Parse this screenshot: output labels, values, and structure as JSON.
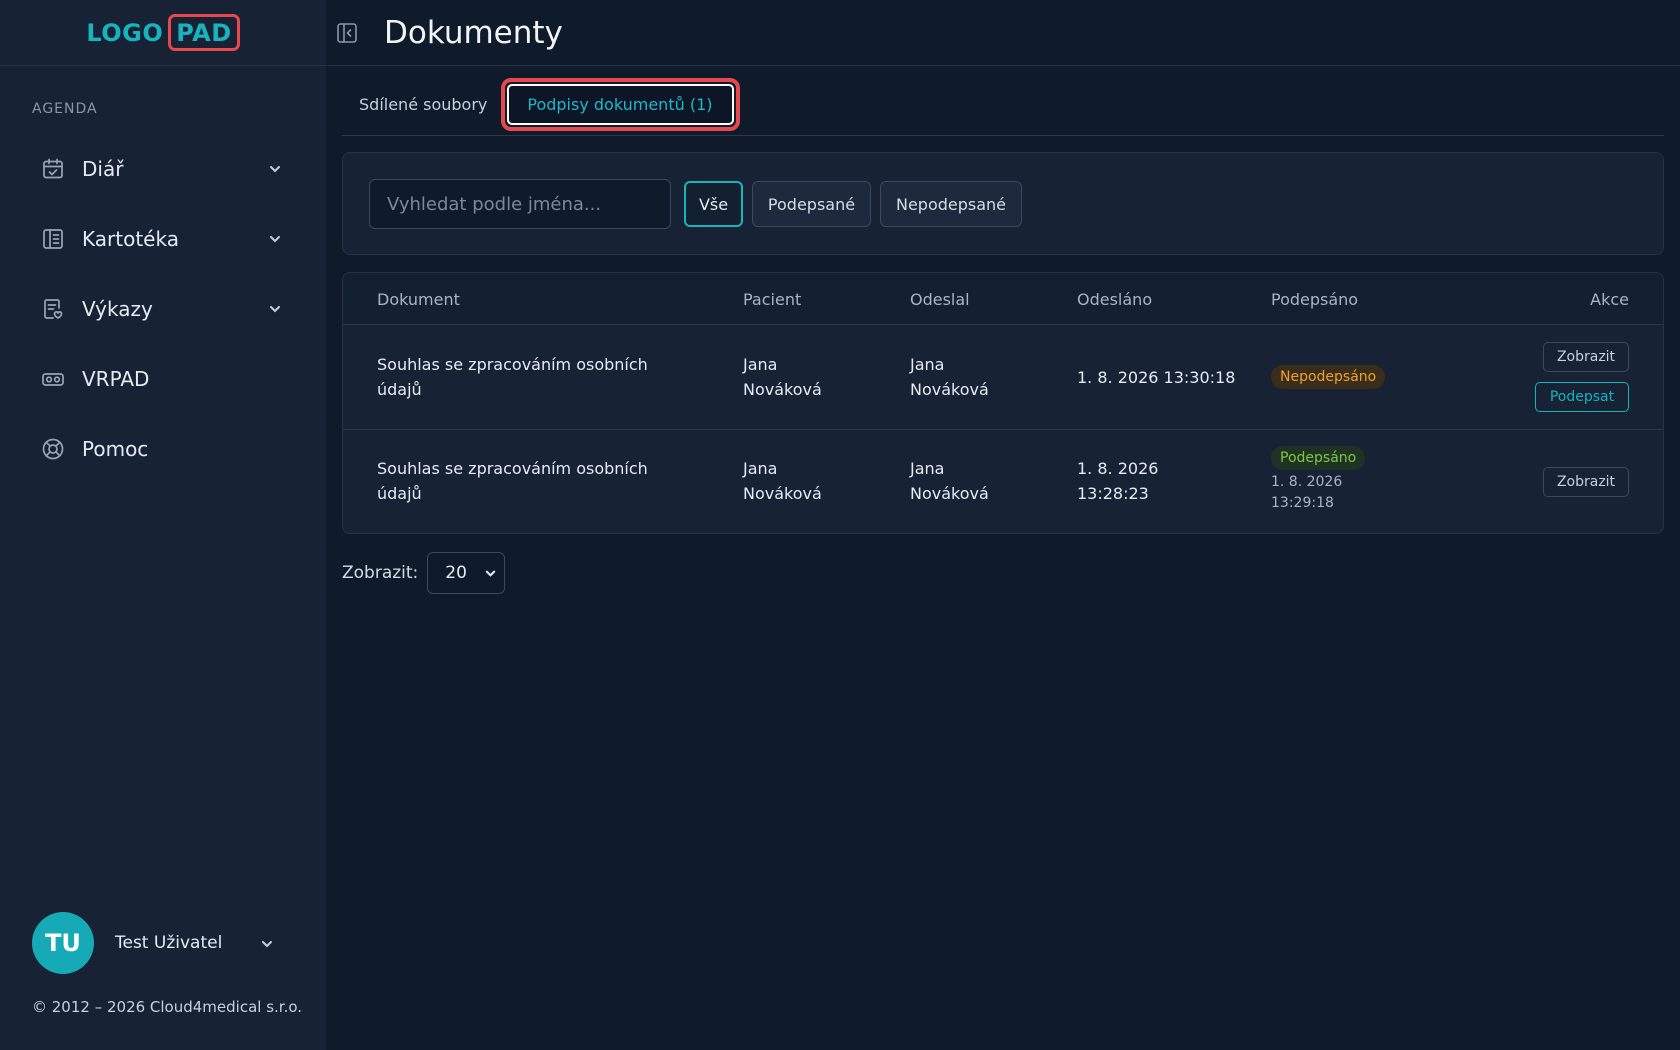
{
  "app": {
    "logo_left": "LOGO",
    "logo_right": "PAD"
  },
  "sidebar": {
    "section_label": "AGENDA",
    "items": [
      {
        "label": "Diář",
        "icon": "calendar-icon"
      },
      {
        "label": "Kartotéka",
        "icon": "card-file-icon"
      },
      {
        "label": "Výkazy",
        "icon": "report-icon"
      },
      {
        "label": "VRPAD",
        "icon": "vr-headset-icon"
      },
      {
        "label": "Pomoc",
        "icon": "lifebuoy-icon"
      }
    ],
    "user": {
      "initials": "TU",
      "name": "Test Uživatel"
    },
    "copyright": "© 2012 – 2026 Cloud4medical s.r.o."
  },
  "header": {
    "title": "Dokumenty"
  },
  "tabs": [
    {
      "label": "Sdílené soubory",
      "active": false
    },
    {
      "label": "Podpisy dokumentů (1)",
      "active": true
    }
  ],
  "filters": {
    "search_placeholder": "Vyhledat podle jména...",
    "buttons": [
      {
        "label": "Vše",
        "active": true
      },
      {
        "label": "Podepsané",
        "active": false
      },
      {
        "label": "Nepodepsané",
        "active": false
      }
    ]
  },
  "table": {
    "columns": [
      "Dokument",
      "Pacient",
      "Odeslal",
      "Odesláno",
      "Podepsáno",
      "Akce"
    ],
    "rows": [
      {
        "document": [
          "Souhlas se zpracováním osobních",
          "údajů"
        ],
        "patient": [
          "Jana",
          "Nováková"
        ],
        "sender": [
          "Jana",
          "Nováková"
        ],
        "sent": [
          "1. 8. 2026 13:30:18"
        ],
        "status": "Nepodepsáno",
        "signed_date": [],
        "actions": [
          "Zobrazit",
          "Podepsat"
        ]
      },
      {
        "document": [
          "Souhlas se zpracováním osobních",
          "údajů"
        ],
        "patient": [
          "Jana",
          "Nováková"
        ],
        "sender": [
          "Jana",
          "Nováková"
        ],
        "sent": [
          "1. 8. 2026",
          "13:28:23"
        ],
        "status": "Podepsáno",
        "signed_date": [
          "1. 8. 2026",
          "13:29:18"
        ],
        "actions": [
          "Zobrazit"
        ]
      }
    ]
  },
  "pager": {
    "label": "Zobrazit:",
    "value": "20"
  },
  "colors": {
    "accent": "#17b3bf",
    "highlight": "#e5484d",
    "warning": "#f0a130",
    "success": "#7cc940",
    "background": "#0f1a2b",
    "sidebar": "#172335"
  }
}
